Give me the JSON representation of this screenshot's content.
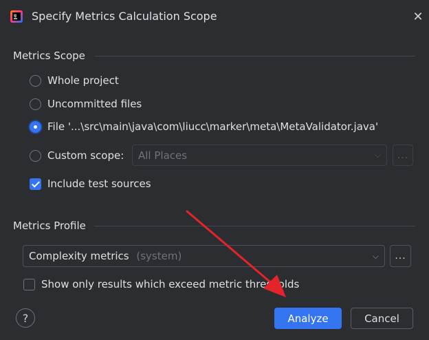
{
  "window": {
    "title": "Specify Metrics Calculation Scope"
  },
  "scope": {
    "section_label": "Metrics Scope",
    "options": [
      {
        "label": "Whole project",
        "selected": false
      },
      {
        "label": "Uncommitted files",
        "selected": false
      },
      {
        "label": "File '...\\src\\main\\java\\com\\liucc\\marker\\meta\\MetaValidator.java'",
        "selected": true
      },
      {
        "label": "Custom scope:",
        "selected": false
      }
    ],
    "custom_scope_value": "All Places",
    "custom_scope_more": "...",
    "include_tests": {
      "label": "Include test sources",
      "checked": true
    }
  },
  "profile": {
    "section_label": "Metrics Profile",
    "selected_name": "Complexity metrics",
    "selected_tag": "(system)",
    "more": "...",
    "exceed_only": {
      "label": "Show only results which exceed metric thresholds",
      "checked": false
    }
  },
  "footer": {
    "help": "?",
    "analyze_label": "Analyze",
    "cancel_label": "Cancel"
  },
  "colors": {
    "background": "#2b2d30",
    "accent": "#3574f0",
    "annotation_arrow": "#e3252b"
  }
}
